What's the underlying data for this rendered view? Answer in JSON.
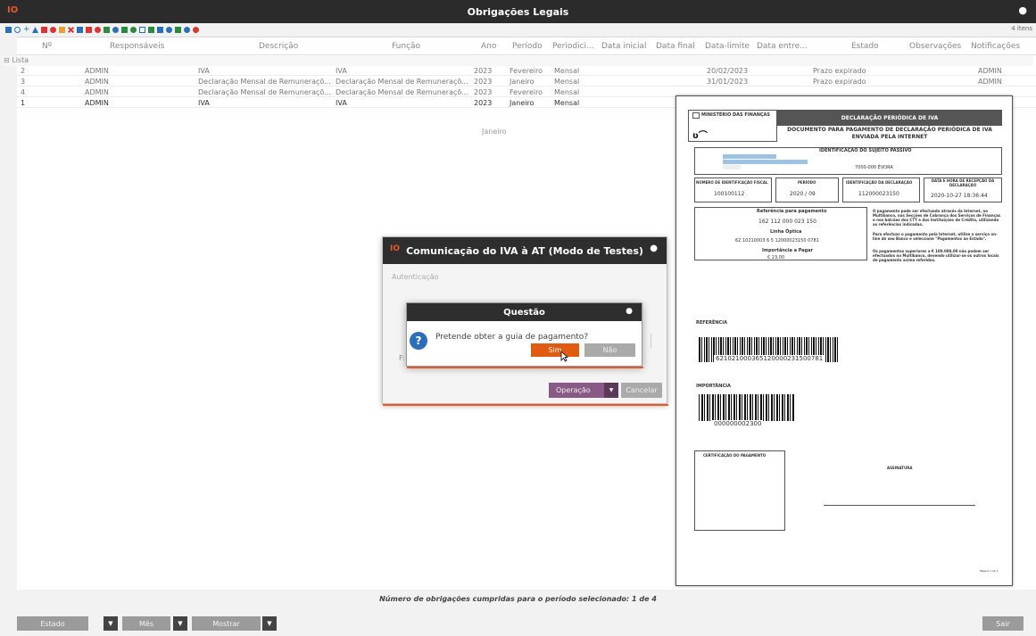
{
  "window": {
    "title": "Obrigações Legais",
    "logo": "IO",
    "close": "●"
  },
  "toolbar": {
    "items_count": "4 itens"
  },
  "grid": {
    "group_label": "⊟ Lista",
    "headers": [
      "Nº",
      "Responsáveis",
      "Descrição",
      "Função",
      "Ano",
      "Período",
      "Periodici...",
      "Data inicial",
      "Data final",
      "Data-limite",
      "Data entre...",
      "Estado",
      "Observações",
      "Notificações"
    ],
    "rows": [
      {
        "n": "2",
        "resp": "ADMIN",
        "desc": "IVA",
        "func": "IVA",
        "ano": "2023",
        "periodo": "Fevereiro",
        "period": "Mensal",
        "limite": "20/02/2023",
        "estado": "Prazo expirado",
        "notif": "ADMIN"
      },
      {
        "n": "3",
        "resp": "ADMIN",
        "desc": "Declaração Mensal de Remuneraçõ...",
        "func": "Declaração Mensal de Remuneraçõ...",
        "ano": "2023",
        "periodo": "Janeiro",
        "period": "Mensal",
        "limite": "31/01/2023",
        "estado": "Prazo expirado",
        "notif": "ADMIN"
      },
      {
        "n": "4",
        "resp": "ADMIN",
        "desc": "Declaração Mensal de Remuneraçõ...",
        "func": "Declaração Mensal de Remuneraçõ...",
        "ano": "2023",
        "periodo": "Fevereiro",
        "period": "Mensal",
        "limite": "",
        "estado": "",
        "notif": ""
      },
      {
        "n": "1",
        "resp": "ADMIN",
        "desc": "IVA",
        "func": "IVA",
        "ano": "2023",
        "periodo": "Janeiro",
        "period": "Mensal",
        "limite": "",
        "estado": "",
        "notif": ""
      }
    ],
    "hint": "Janeiro"
  },
  "footer": {
    "summary": "Número de obrigações cumpridas para o período selecionado: 1 de 4",
    "estado": "Estado",
    "mes": "Mês",
    "mostrar": "Mostrar",
    "sair": "Sair"
  },
  "dialog_at": {
    "title": "Comunicação do IVA à AT (Modo de Testes)",
    "section": "Autenticação",
    "field_prefix": "F:",
    "operation": "Operação",
    "cancel": "Cancelar"
  },
  "dialog_q": {
    "title": "Questão",
    "message": "Pretende obter a guia de pagamento?",
    "yes": "Sim",
    "no": "Não"
  },
  "doc": {
    "ministry": "MINISTÉRIO DAS FINANÇAS",
    "header": "DECLARAÇÃO PERIÓDICA DE IVA",
    "subtitle1": "DOCUMENTO PARA PAGAMENTO DE DECLARAÇÃO PERIÓDICA DE IVA",
    "subtitle2": "ENVIADA PELA INTERNET",
    "id_title": "IDENTIFICAÇÃO DO SUJEITO PASSIVO",
    "city": "7000-000 ÉVORA",
    "h_nif": "NÚMERO DE IDENTIFICAÇÃO FISCAL",
    "h_periodo": "PERÍODO",
    "h_ident": "IDENTIFICAÇÃO DA DECLARAÇÃO",
    "h_data": "DATA E HORA DE RECEPÇÃO DA DECLARAÇÃO",
    "nif": "100100112",
    "periodo": "2020 / 09",
    "ident": "112000023150",
    "data": "2020-10-27 18:36:44",
    "ref_title": "Referência para pagamento",
    "ref": "162 112 000 023 150",
    "linha_title": "Linha Óptica",
    "linha": "62 10210003 6 5 12000023150 0781",
    "imp_title": "Importância a Pagar",
    "imp": "€ 23,00",
    "note1": "O pagamento pode ser efectuado através da Internet, no Multibanco, nas Secções de Cobrança dos Serviços de Finanças e nos balcões dos CTT e das Instituições de Crédito, utilizando as referências indicadas.",
    "note2": "Para efectuar o pagamento pela Internet, utilize o serviço on-line do seu Banco e seleccione \"Pagamentos ao Estado\".",
    "note3": "Os pagamentos superiores a € 100.000,00 não podem ser efectuados no Multibanco, devendo utilizar-se os outros locais de pagamento acima referidos.",
    "referencia": "REFERÊNCIA",
    "barcode1": "621021000365120000231500781",
    "importancia": "IMPORTÂNCIA",
    "barcode2": "000000002300",
    "cert": "CERTIFICAÇÃO DO PAGAMENTO",
    "assinatura": "ASSINATURA",
    "page": "Página 1 de 1"
  }
}
